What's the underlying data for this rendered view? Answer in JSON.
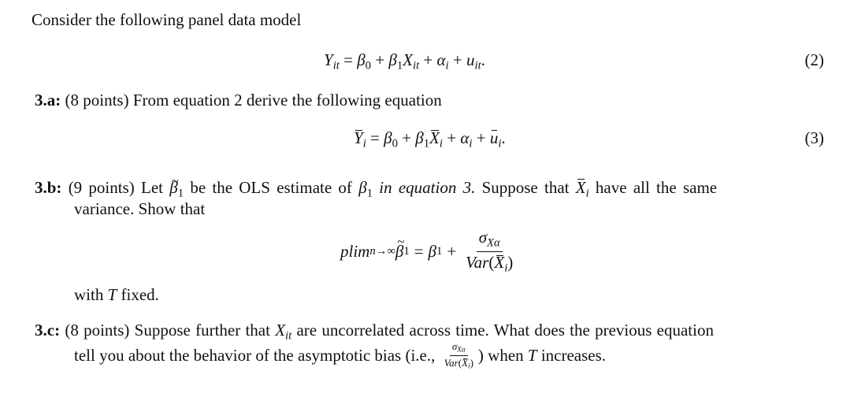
{
  "intro": "Consider the following panel data model",
  "equations": [
    {
      "number": "(2)",
      "latex": "Y_{it} = \\beta_0 + \\beta_1 X_{it} + \\alpha_i + u_{it}."
    },
    {
      "number": "(3)",
      "latex": "\\bar{Y}_i = \\beta_0 + \\beta_1 \\bar{X}_i + \\alpha_i + \\bar{u}_i."
    },
    {
      "number": "",
      "latex": "plim_{n\\to\\infty}\\tilde{\\beta}_1 = \\beta_1 + \\frac{\\sigma_{X\\alpha}}{Var(\\bar{X}_i)}"
    }
  ],
  "questions": {
    "a": {
      "label": "3.a:",
      "points": "(8 points)",
      "text": "From equation 2 derive the following equation"
    },
    "b": {
      "label": "3.b:",
      "points": "(9 points)",
      "text_1": "Let",
      "text_2": "be the OLS estimate of",
      "text_3": "in equation 3.",
      "text_4": "Suppose that",
      "text_5": "have all the same",
      "text_6": "variance. Show that",
      "after": "with",
      "after_2": "fixed."
    },
    "c": {
      "label": "3.c:",
      "points": "(8 points)",
      "text_1": "Suppose further that",
      "text_2": "are uncorrelated across time. What does the previous equation",
      "text_3": "tell you about the behavior of the asymptotic bias (i.e.,",
      "text_4": ") when",
      "text_5": "increases."
    }
  },
  "symbols": {
    "Y": "Y",
    "X": "X",
    "it": "it",
    "i": "i",
    "beta": "β",
    "zero": "0",
    "one": "1",
    "alpha": "α",
    "u": "u",
    "plus": "+",
    "eq": "=",
    "T": "T",
    "sigma": "σ",
    "Var": "Var",
    "plim": "plim",
    "n_inf": "n→∞",
    "dot": ".",
    "lp": "(",
    "rp": ")"
  }
}
